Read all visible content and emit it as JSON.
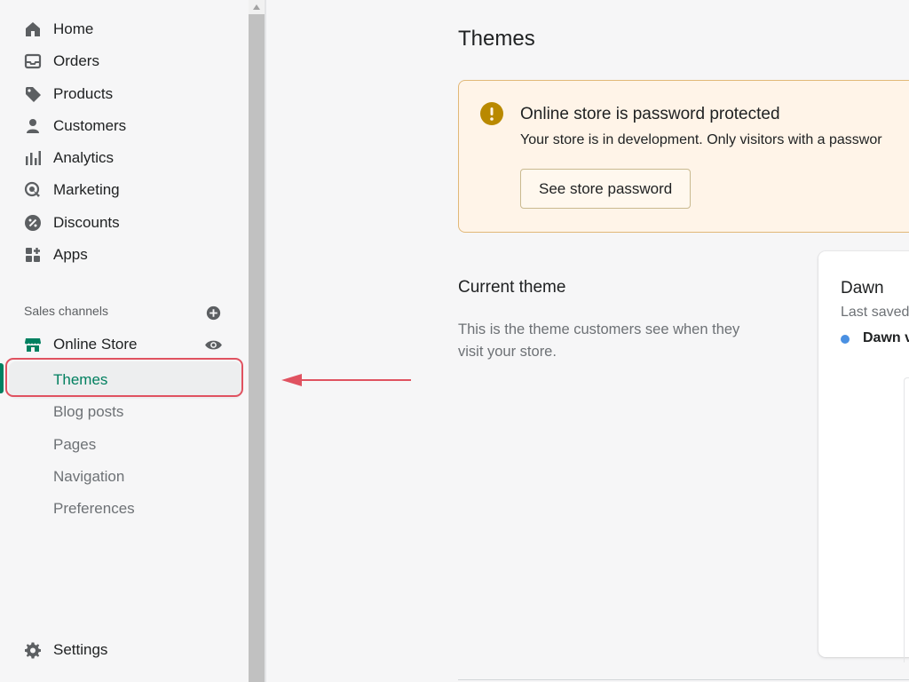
{
  "sidebar": {
    "nav": [
      {
        "label": "Home",
        "icon": "home-icon"
      },
      {
        "label": "Orders",
        "icon": "orders-icon"
      },
      {
        "label": "Products",
        "icon": "tag-icon"
      },
      {
        "label": "Customers",
        "icon": "person-icon"
      },
      {
        "label": "Analytics",
        "icon": "bar-chart-icon"
      },
      {
        "label": "Marketing",
        "icon": "target-icon"
      },
      {
        "label": "Discounts",
        "icon": "discount-icon"
      },
      {
        "label": "Apps",
        "icon": "apps-icon"
      }
    ],
    "sales_channels_title": "Sales channels",
    "online_store": "Online Store",
    "sub_items": [
      "Themes",
      "Blog posts",
      "Pages",
      "Navigation",
      "Preferences"
    ],
    "settings": "Settings"
  },
  "main": {
    "title": "Themes",
    "banner": {
      "title": "Online store is password protected",
      "text": "Your store is in development. Only visitors with a passwor",
      "button": "See store password"
    },
    "current_theme": {
      "title": "Current theme",
      "description": "This is the theme customers see when they visit your store."
    },
    "theme_card": {
      "name": "Dawn",
      "saved": "Last saved",
      "version": "Dawn v"
    }
  },
  "colors": {
    "accent": "#008060",
    "active_text": "#007f5f",
    "banner_bg": "#fff4e8",
    "warning_icon": "#b98900",
    "annotation": "#e05260"
  }
}
